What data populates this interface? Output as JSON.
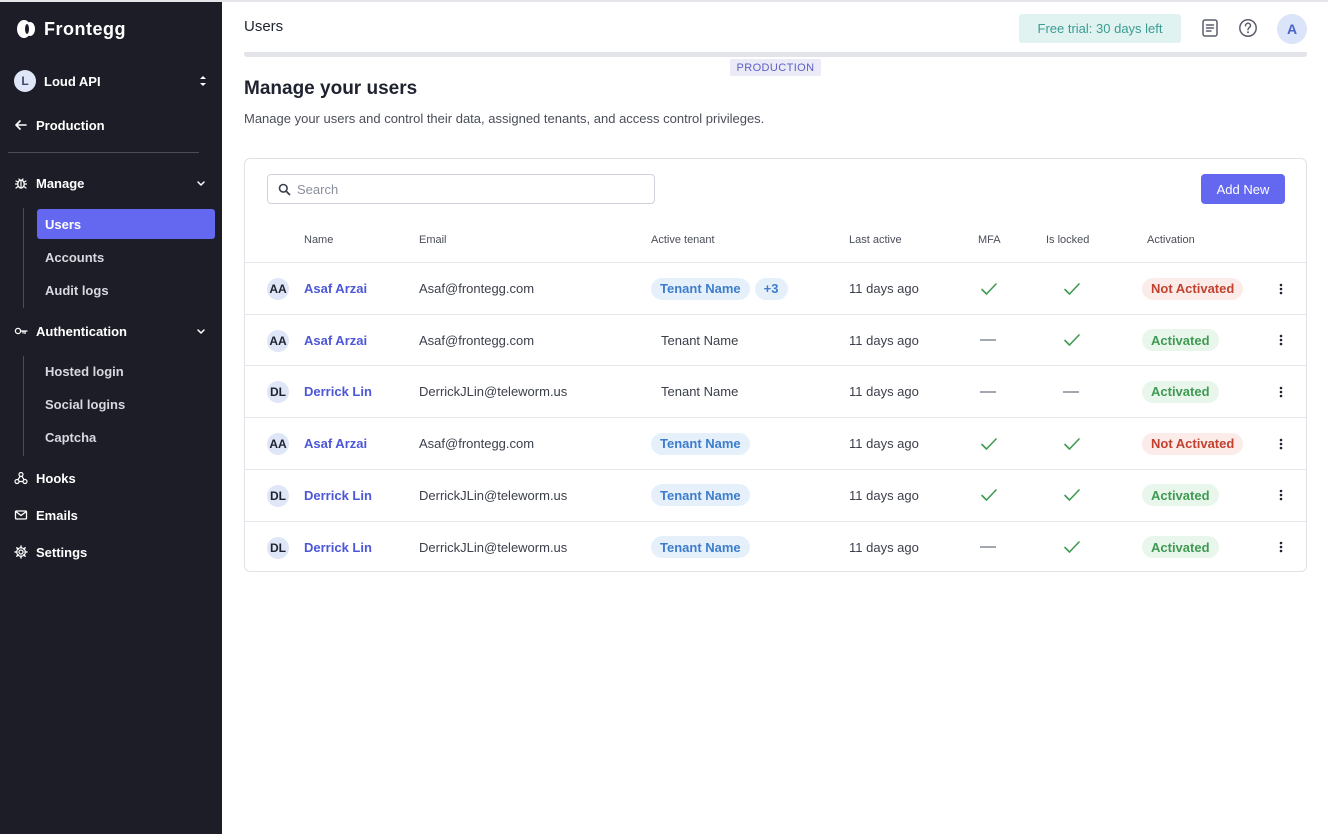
{
  "sidebar": {
    "brand": "Frontegg",
    "environment": {
      "avatar": "L",
      "name": "Loud API"
    },
    "back_label": "Production",
    "groups": [
      {
        "label": "Manage",
        "items": [
          "Users",
          "Accounts",
          "Audit logs"
        ]
      },
      {
        "label": "Authentication",
        "items": [
          "Hosted login",
          "Social logins",
          "Captcha"
        ]
      }
    ],
    "links": [
      "Hooks",
      "Emails",
      "Settings"
    ]
  },
  "header": {
    "title": "Users",
    "trial": "Free trial: 30 days left",
    "user_avatar": "A",
    "env_tag": "PRODUCTION"
  },
  "page": {
    "title": "Manage your users",
    "subtitle": "Manage your users and control their data, assigned tenants, and access control privileges."
  },
  "table": {
    "search_placeholder": "Search",
    "add_button": "Add New",
    "columns": [
      "Name",
      "Email",
      "Active tenant",
      "Last active",
      "MFA",
      "Is locked",
      "Activation"
    ],
    "rows": [
      {
        "initials": "AA",
        "name": "Asaf Arzai",
        "email": "Asaf@frontegg.com",
        "tenant": "Tenant Name",
        "tenant_chip": true,
        "extra": "+3",
        "last_active": "11 days ago",
        "mfa": true,
        "locked": true,
        "activation": "Not Activated",
        "activated": false
      },
      {
        "initials": "AA",
        "name": "Asaf Arzai",
        "email": "Asaf@frontegg.com",
        "tenant": "Tenant Name",
        "tenant_chip": false,
        "extra": "",
        "last_active": "11 days ago",
        "mfa": false,
        "locked": true,
        "activation": "Activated",
        "activated": true
      },
      {
        "initials": "DL",
        "name": "Derrick Lin",
        "email": "DerrickJLin@teleworm.us",
        "tenant": "Tenant Name",
        "tenant_chip": false,
        "extra": "",
        "last_active": "11 days ago",
        "mfa": false,
        "locked": false,
        "activation": "Activated",
        "activated": true
      },
      {
        "initials": "AA",
        "name": "Asaf Arzai",
        "email": "Asaf@frontegg.com",
        "tenant": "Tenant Name",
        "tenant_chip": true,
        "extra": "",
        "last_active": "11 days ago",
        "mfa": true,
        "locked": true,
        "activation": "Not Activated",
        "activated": false
      },
      {
        "initials": "DL",
        "name": "Derrick Lin",
        "email": "DerrickJLin@teleworm.us",
        "tenant": "Tenant Name",
        "tenant_chip": true,
        "extra": "",
        "last_active": "11 days ago",
        "mfa": true,
        "locked": true,
        "activation": "Activated",
        "activated": true
      },
      {
        "initials": "DL",
        "name": "Derrick Lin",
        "email": "DerrickJLin@teleworm.us",
        "tenant": "Tenant Name",
        "tenant_chip": true,
        "extra": "",
        "last_active": "11 days ago",
        "mfa": false,
        "locked": true,
        "activation": "Activated",
        "activated": true
      }
    ]
  },
  "colors": {
    "accent": "#6468f0",
    "sidebar_bg": "#1c1d26",
    "success": "#3f9a52",
    "danger": "#c2412f"
  }
}
